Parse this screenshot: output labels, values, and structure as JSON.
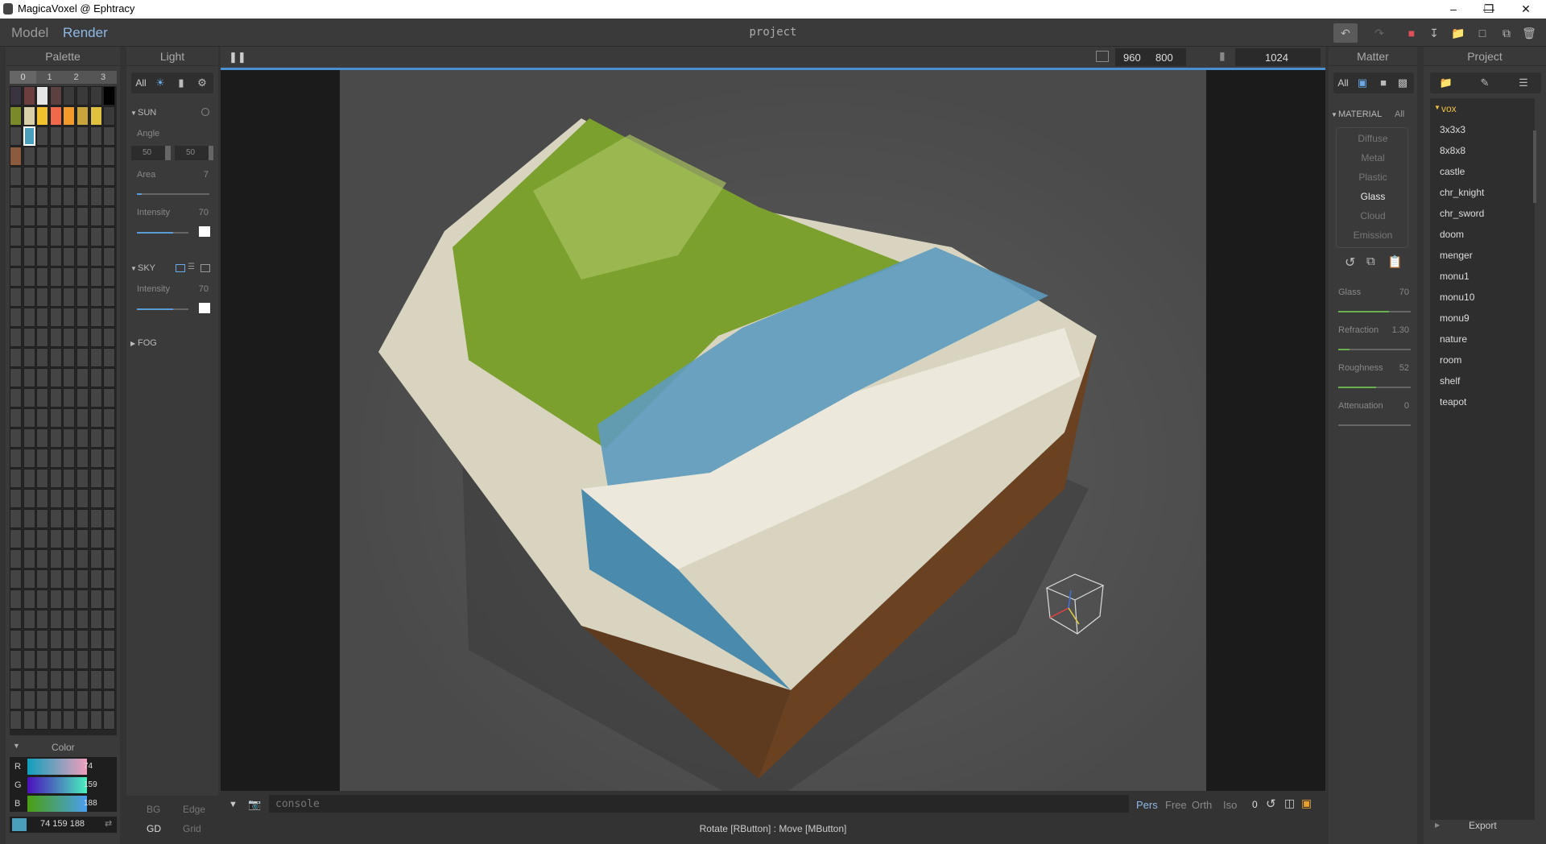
{
  "window": {
    "title": "MagicaVoxel @ Ephtracy"
  },
  "topbar": {
    "mode_model": "Model",
    "mode_render": "Render",
    "project_title": "project"
  },
  "palette": {
    "title": "Palette",
    "tabs": [
      "0",
      "1",
      "2",
      "3"
    ],
    "colors_row1": [
      "#3a3340",
      "#6b3f3f",
      "#e6e6e6",
      "#5a4040",
      "#3a3a3a",
      "#3a3a3a",
      "#3a3a3a",
      "#000000"
    ],
    "colors_row2": [
      "#7a8a2a",
      "#d9cfa8",
      "#f2c12e",
      "#ef6a4a",
      "#f29b2a",
      "#c9a43a",
      "#e0c040",
      "#3a3a3a"
    ],
    "selected_color": "#4a9fbc",
    "extra_color": "#8c5a3c"
  },
  "color": {
    "title": "Color",
    "r_label": "R",
    "g_label": "G",
    "b_label": "B",
    "r": "74",
    "g": "159",
    "b": "188",
    "rgb": "74 159 188",
    "swatch": "#4a9fbc"
  },
  "bottomleft": {
    "bg": "BG",
    "edge": "Edge",
    "gd": "GD",
    "grid": "Grid"
  },
  "light": {
    "title": "Light",
    "tab_all": "All",
    "sun": {
      "label": "SUN",
      "angle_label": "Angle",
      "angle1": "50",
      "angle2": "50",
      "area_label": "Area",
      "area": "7",
      "intensity_label": "Intensity",
      "intensity": "70"
    },
    "sky": {
      "label": "SKY",
      "intensity_label": "Intensity",
      "intensity": "70"
    },
    "fog": {
      "label": "FOG"
    }
  },
  "viewport": {
    "width": "960",
    "height": "800",
    "samples": "1024",
    "console_placeholder": "console",
    "cam_pers": "Pers",
    "cam_free": "Free",
    "cam_orth": "Orth",
    "cam_iso": "Iso",
    "cam_num": "0",
    "status": "Rotate [RButton] : Move [MButton]"
  },
  "matter": {
    "title": "Matter",
    "tab_all": "All",
    "material_label": "MATERIAL",
    "material_all": "All",
    "types": [
      "Diffuse",
      "Metal",
      "Plastic",
      "Glass",
      "Cloud",
      "Emission"
    ],
    "selected": "Glass",
    "glass_label": "Glass",
    "glass": "70",
    "refraction_label": "Refraction",
    "refraction": "1.30",
    "roughness_label": "Roughness",
    "roughness": "52",
    "attenuation_label": "Attenuation",
    "attenuation": "0"
  },
  "project": {
    "title": "Project",
    "folder": "vox",
    "files": [
      "3x3x3",
      "8x8x8",
      "castle",
      "chr_knight",
      "chr_sword",
      "doom",
      "menger",
      "monu1",
      "monu10",
      "monu9",
      "nature",
      "room",
      "shelf",
      "teapot"
    ],
    "export": "Export"
  }
}
